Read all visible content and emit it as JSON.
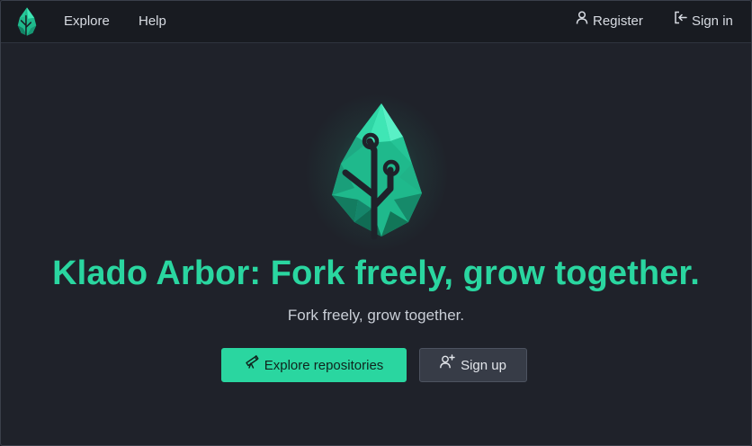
{
  "navbar": {
    "logo_icon": "klado-arbor-leaf-logo",
    "explore_label": "Explore",
    "help_label": "Help",
    "register_label": "Register",
    "register_icon": "person-icon",
    "signin_label": "Sign in",
    "signin_icon": "sign-in-icon"
  },
  "hero": {
    "logo_icon": "klado-arbor-leaf-logo",
    "title": "Klado Arbor: Fork freely, grow together.",
    "subtitle": "Fork freely, grow together.",
    "explore_button_label": "Explore repositories",
    "explore_button_icon": "telescope-icon",
    "signup_button_label": "Sign up",
    "signup_button_icon": "person-add-icon"
  },
  "colors": {
    "accent": "#2ad6a0",
    "background": "#1f222a",
    "navbar": "#181b21",
    "secondary_button": "#373c47"
  }
}
